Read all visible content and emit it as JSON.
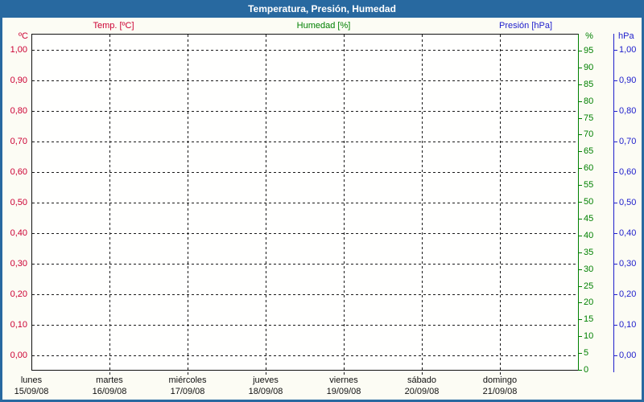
{
  "window": {
    "title": "Temperatura, Presión, Humedad"
  },
  "legend": {
    "temp": "Temp. [ºC]",
    "humidity": "Humedad [%]",
    "pressure": "Presión [hPa]"
  },
  "axes": {
    "temp_unit": "ºC",
    "humidity_unit": "%",
    "pressure_unit": "hPa",
    "temp_ticks": [
      "1,00",
      "0,90",
      "0,80",
      "0,70",
      "0,60",
      "0,50",
      "0,40",
      "0,30",
      "0,20",
      "0,10",
      "0,00"
    ],
    "pressure_ticks": [
      "1,00",
      "0,90",
      "0,80",
      "0,70",
      "0,60",
      "0,50",
      "0,40",
      "0,30",
      "0,20",
      "0,10",
      "0,00"
    ],
    "humidity_ticks": [
      "95",
      "90",
      "85",
      "80",
      "75",
      "70",
      "65",
      "60",
      "55",
      "50",
      "45",
      "40",
      "35",
      "30",
      "25",
      "20",
      "15",
      "10",
      "5",
      "0"
    ],
    "days": [
      {
        "name": "lunes",
        "date": "15/09/08"
      },
      {
        "name": "martes",
        "date": "16/09/08"
      },
      {
        "name": "miércoles",
        "date": "17/09/08"
      },
      {
        "name": "jueves",
        "date": "18/09/08"
      },
      {
        "name": "viernes",
        "date": "19/09/08"
      },
      {
        "name": "sábado",
        "date": "20/09/08"
      },
      {
        "name": "domingo",
        "date": "21/09/08"
      }
    ]
  },
  "colors": {
    "frame_blue": "#2869A0",
    "temp_red": "#CC0033",
    "humidity_green": "#008000",
    "pressure_blue": "#2020CC",
    "grid_black": "#1A1A1A",
    "background": "#FCFCF4"
  },
  "chart_data": {
    "type": "line",
    "title": "Temperatura, Presión, Humedad",
    "x": {
      "categories": [
        "lunes 15/09/08",
        "martes 16/09/08",
        "miércoles 17/09/08",
        "jueves 18/09/08",
        "viernes 19/09/08",
        "sábado 20/09/08",
        "domingo 21/09/08"
      ]
    },
    "series": [
      {
        "name": "Temp. [ºC]",
        "unit": "ºC",
        "color": "#CC0033",
        "axis": "left",
        "axis_range": [
          0.0,
          1.0
        ],
        "tick_step": 0.1,
        "values": []
      },
      {
        "name": "Humedad [%]",
        "unit": "%",
        "color": "#008000",
        "axis": "right-inner",
        "axis_range": [
          0,
          100
        ],
        "tick_step": 5,
        "values": []
      },
      {
        "name": "Presión [hPa]",
        "unit": "hPa",
        "color": "#2020CC",
        "axis": "right-outer",
        "axis_range": [
          0.0,
          1.0
        ],
        "tick_step": 0.1,
        "values": []
      }
    ],
    "grid": true,
    "legend_position": "top",
    "plot_is_empty": true
  }
}
